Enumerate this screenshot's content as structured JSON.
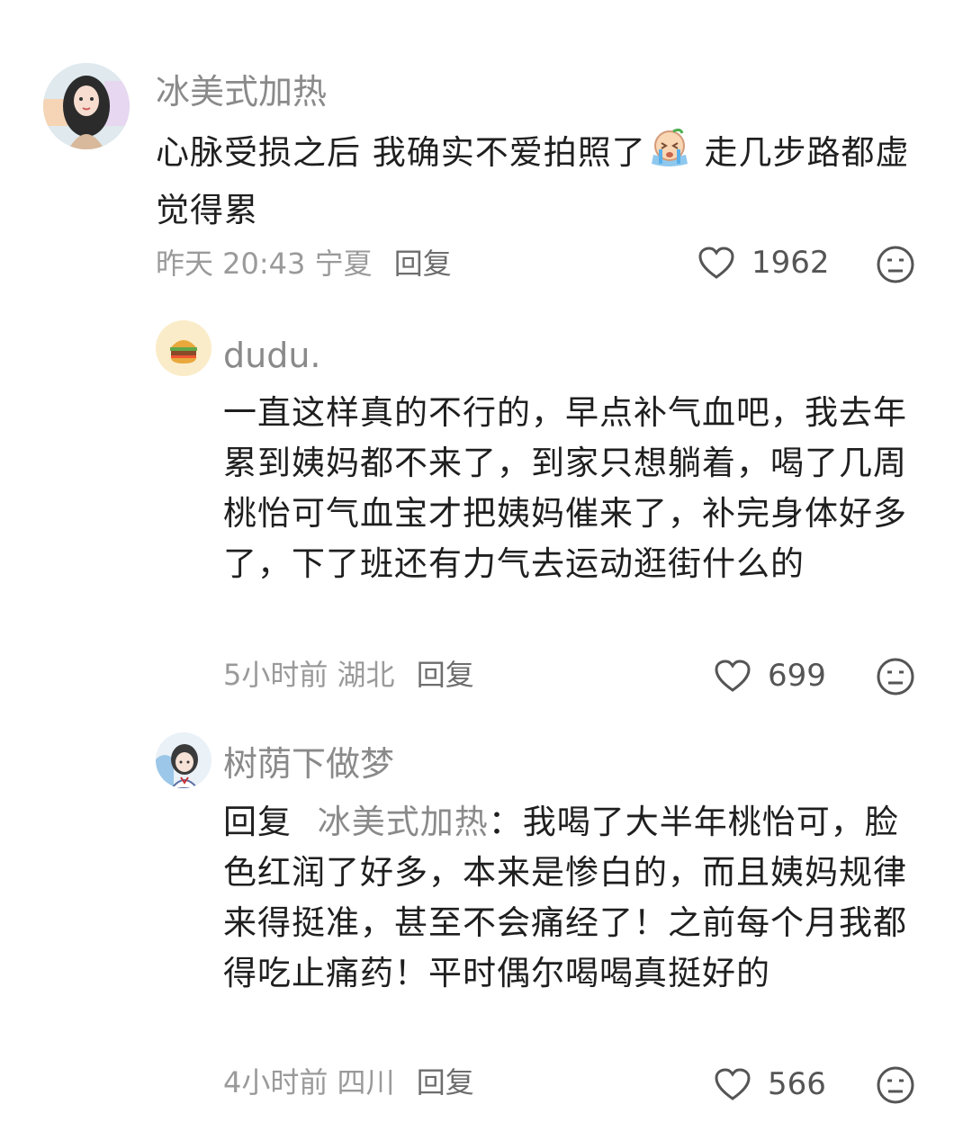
{
  "comments": [
    {
      "username": "冰美式加热",
      "text_a": "心脉受损之后 我确实不爱拍照了",
      "text_b": " 走几步路都虚觉得累",
      "time": "昨天 20:43",
      "location": "宁夏",
      "reply_label": "回复",
      "likes": "1962",
      "emoji": "crying-face-emoji"
    },
    {
      "username": "dudu.",
      "text": "一直这样真的不行的，早点补气血吧，我去年累到姨妈都不来了，到家只想躺着，喝了几周桃怡可气血宝才把姨妈催来了，补完身体好多了，下了班还有力气去运动逛街什么的",
      "time": "5小时前",
      "location": "湖北",
      "reply_label": "回复",
      "likes": "699"
    },
    {
      "username": "树荫下做梦",
      "reply_prefix": "回复",
      "reply_to": "冰美式加热",
      "text": "：我喝了大半年桃怡可，脸色红润了好多，本来是惨白的，而且姨妈规律来得挺准，甚至不会痛经了！之前每个月我都得吃止痛药！平时偶尔喝喝真挺好的",
      "time": "4小时前",
      "location": "四川",
      "reply_label": "回复",
      "likes": "566"
    }
  ],
  "icons": {
    "like": "heart-outline-icon",
    "dislike": "meh-face-icon"
  }
}
